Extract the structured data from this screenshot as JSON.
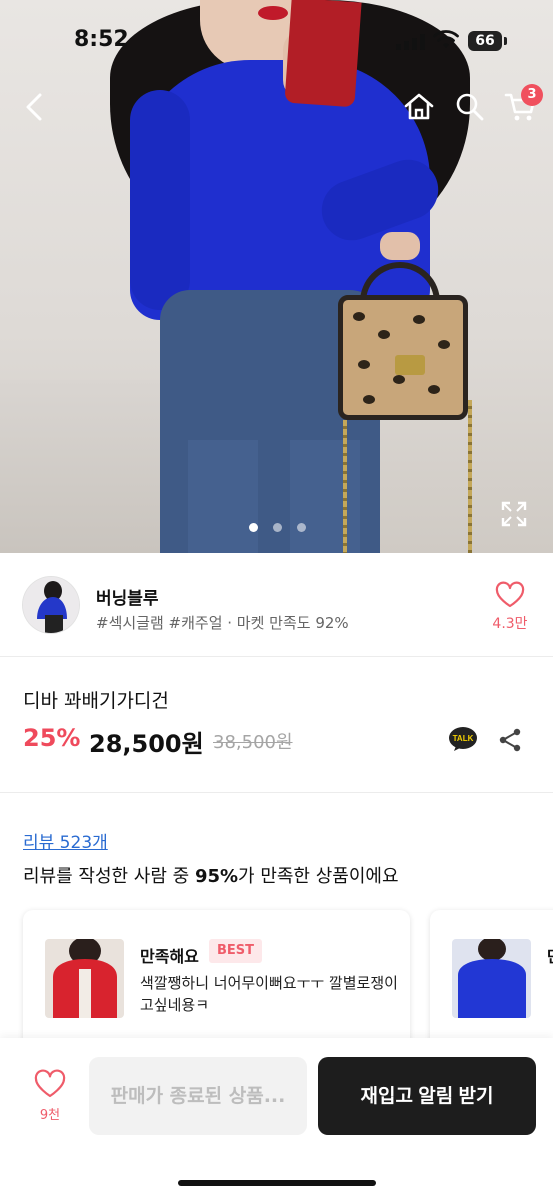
{
  "status_bar": {
    "time": "8:52",
    "battery": "66"
  },
  "header": {
    "cart_count": "3"
  },
  "gallery": {
    "page_count": 3,
    "current_page": 1
  },
  "shop": {
    "name": "버닝블루",
    "tags": "#섹시글램 #캐주얼 · 마켓 만족도 92%",
    "like_count": "4.3만"
  },
  "product": {
    "name": "디바 꽈배기가디건",
    "discount": "25%",
    "price": "28,500원",
    "original_price": "38,500원",
    "talk_label": "TALK"
  },
  "reviews": {
    "link": "리뷰 523개",
    "summary_prefix": "리뷰를 작성한 사람 중 ",
    "summary_percent": "95%",
    "summary_suffix": "가 만족한 상품이에요",
    "cards": [
      {
        "title": "만족해요",
        "badge": "BEST",
        "text": "색깔쨍하니 너어무이뻐요ㅜㅜ 깔별로쟁이고싶네용ㅋ"
      },
      {
        "title": "만",
        "badge": "",
        "text": ""
      }
    ]
  },
  "bottom_bar": {
    "wish_count": "9천",
    "sold_out_button": "판매가 종료된 상품...",
    "restock_button": "재입고 알림 받기"
  },
  "colors": {
    "accent": "#ef4a5c",
    "link": "#2a6bd1",
    "cardigan": "#1f2fcf",
    "dark_button": "#1d1d1d"
  }
}
